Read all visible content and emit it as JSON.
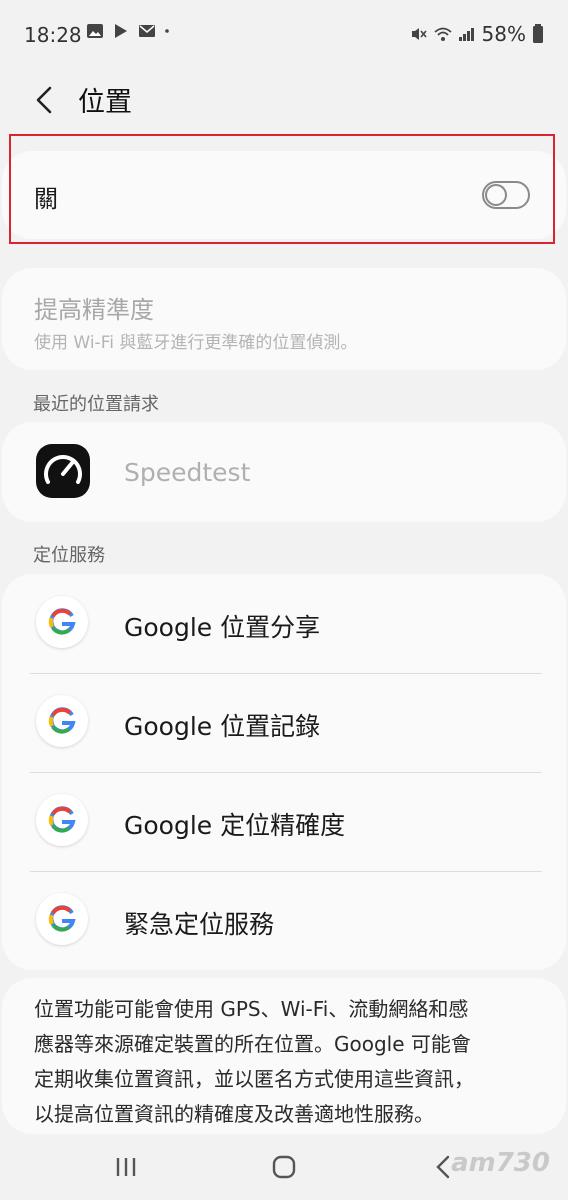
{
  "status_bar": {
    "time": "18:28",
    "battery": "58%"
  },
  "header": {
    "title": "位置"
  },
  "location_toggle": {
    "label": "關",
    "state": "off"
  },
  "accuracy": {
    "title": "提高精準度",
    "subtitle": "使用 Wi-Fi 與藍牙進行更準確的位置偵測。"
  },
  "recent": {
    "section_title": "最近的位置請求",
    "apps": [
      {
        "name": "Speedtest"
      }
    ]
  },
  "services": {
    "section_title": "定位服務",
    "items": [
      {
        "label": "Google 位置分享"
      },
      {
        "label": "Google 位置記錄"
      },
      {
        "label": "Google 定位精確度"
      },
      {
        "label": "緊急定位服務"
      }
    ]
  },
  "info": {
    "lines": [
      "位置功能可能會使用 GPS、Wi-Fi、流動網絡和感",
      "應器等來源確定裝置的所在位置。Google 可能會",
      "定期收集位置資訊，並以匿名方式使用這些資訊，",
      "以提高位置資訊的精確度及改善適地性服務。"
    ]
  },
  "watermark": "am730",
  "colors": {
    "highlight": "#d8262e",
    "background": "#f2f2f2",
    "card": "#fafafa"
  }
}
